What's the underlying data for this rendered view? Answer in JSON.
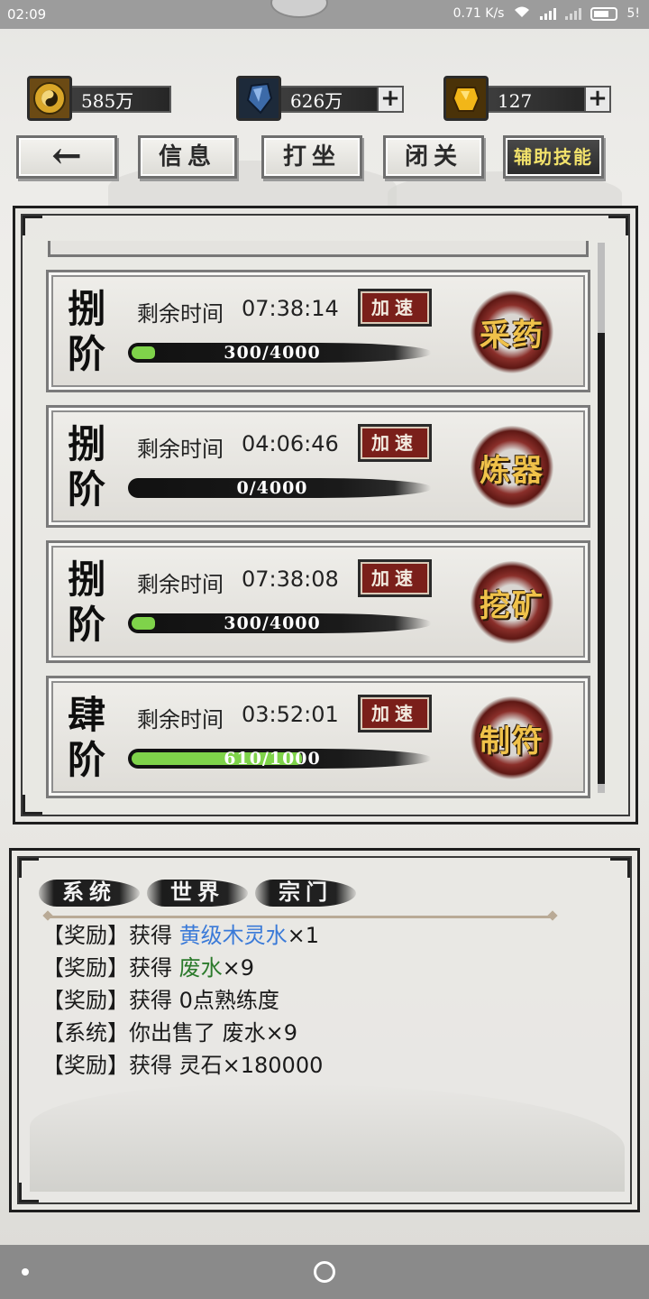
{
  "status": {
    "time": "02:09",
    "net_speed": "0.71 K/s",
    "sim_label": "5!"
  },
  "resources": [
    {
      "icon": "bagua-coin-icon",
      "value": "585万"
    },
    {
      "icon": "blue-crystal-icon",
      "value": "626万",
      "plus": "+"
    },
    {
      "icon": "gold-ingot-icon",
      "value": "127",
      "plus": "+"
    }
  ],
  "nav": {
    "back": "←",
    "tabs": [
      "信息",
      "打坐",
      "闭关",
      "辅助技能"
    ]
  },
  "speed_label": "加速",
  "time_label": "剩余时间",
  "cards": [
    {
      "tier": [
        "捌",
        "阶"
      ],
      "time": "07:38:14",
      "progress_text": "300/4000",
      "progress": 0.075,
      "skill": "采药"
    },
    {
      "tier": [
        "捌",
        "阶"
      ],
      "time": "04:06:46",
      "progress_text": "0/4000",
      "progress": 0.0,
      "skill": "炼器"
    },
    {
      "tier": [
        "捌",
        "阶"
      ],
      "time": "07:38:08",
      "progress_text": "300/4000",
      "progress": 0.075,
      "skill": "挖矿"
    },
    {
      "tier": [
        "肆",
        "阶"
      ],
      "time": "03:52:01",
      "progress_text": "610/1000",
      "progress": 0.61,
      "skill": "制符"
    }
  ],
  "log": {
    "tabs": [
      "系统",
      "世界",
      "宗门"
    ],
    "lines": [
      {
        "tag": "【奖励】",
        "pre": "获得 ",
        "hl": "黄级木灵水",
        "hl_color": "blue",
        "post": "×1"
      },
      {
        "tag": "【奖励】",
        "pre": "获得 ",
        "hl": "废水",
        "hl_color": "green",
        "post": "×9"
      },
      {
        "tag": "【奖励】",
        "pre": "获得 0点熟练度",
        "hl": "",
        "hl_color": "",
        "post": ""
      },
      {
        "tag": "【系统】",
        "pre": "你出售了 废水×9",
        "hl": "",
        "hl_color": "",
        "post": ""
      },
      {
        "tag": "【奖励】",
        "pre": "获得 灵石×180000",
        "hl": "",
        "hl_color": "",
        "post": ""
      }
    ]
  }
}
